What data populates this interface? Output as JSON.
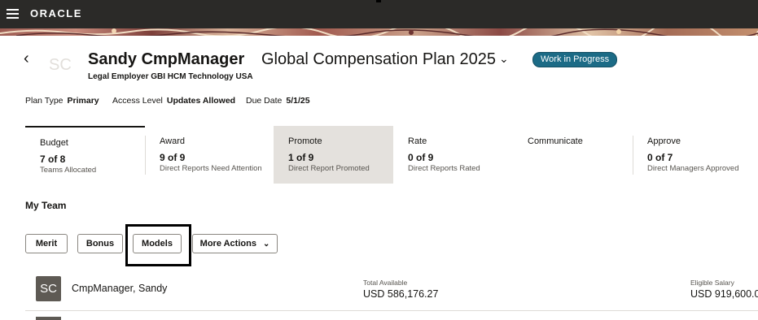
{
  "app": {
    "logo": "ORACLE"
  },
  "header": {
    "back_icon": "chevron-left-icon",
    "avatar_initials": "SC",
    "person_name": "Sandy CmpManager",
    "plan_name": "Global Compensation Plan 2025",
    "plan_chevron": "⌄",
    "status": "Work in Progress",
    "status_color": "#1c6b86",
    "legal_employer": "Legal Employer GBI HCM Technology USA"
  },
  "meta": [
    {
      "label": "Plan Type",
      "value": "Primary"
    },
    {
      "label": "Access Level",
      "value": "Updates Allowed"
    },
    {
      "label": "Due Date",
      "value": "5/1/25"
    }
  ],
  "tabs": [
    {
      "title": "Budget",
      "value": "7 of 8",
      "sub": "Teams Allocated"
    },
    {
      "title": "Award",
      "value": "9 of 9",
      "sub": "Direct Reports Need Attention"
    },
    {
      "title": "Promote",
      "value": "1 of 9",
      "sub": "Direct Report Promoted"
    },
    {
      "title": "Rate",
      "value": "0 of 9",
      "sub": "Direct Reports Rated"
    },
    {
      "title": "Communicate",
      "value": "",
      "sub": ""
    },
    {
      "title": "Approve",
      "value": "0 of 7",
      "sub": "Direct Managers Approved"
    }
  ],
  "team": {
    "heading": "My Team",
    "buttons": {
      "merit": "Merit",
      "bonus": "Bonus",
      "models": "Models",
      "more_actions": "More Actions",
      "more_chevron": "⌄"
    },
    "rows": [
      {
        "initials": "SC",
        "name": "CmpManager, Sandy",
        "total_available_label": "Total Available",
        "total_available": "USD 586,176.27",
        "eligible_salary_label": "Eligible Salary",
        "eligible_salary": "USD 919,600.0"
      }
    ]
  }
}
